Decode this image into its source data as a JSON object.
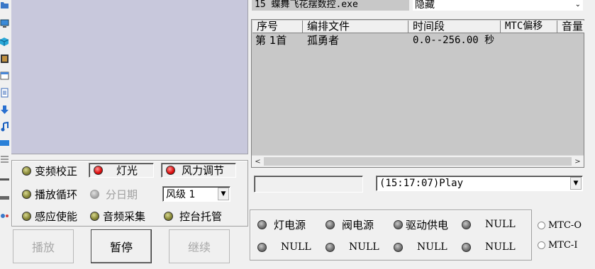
{
  "toolbar_icons": [
    "folder-icon",
    "monitor-icon",
    "cube-icon",
    "film-icon",
    "window-icon",
    "document-icon",
    "download-arrow-icon",
    "music-note-icon",
    "screen-icon",
    "list-icon",
    "dash-icon",
    "panel-icon",
    "network-icon"
  ],
  "top": {
    "program_field": "15 蝶舞飞花摆数控.exe",
    "visibility_select": "隐藏"
  },
  "controls": {
    "freq_correct": "变频校正",
    "lights": "灯光",
    "wind_adjust": "风力调节",
    "play_loop": "播放循环",
    "by_date": "分日期",
    "wind_level_select": "风级 1",
    "sensor_enable": "感应使能",
    "audio_capture": "音频采集",
    "console_host": "控台托管"
  },
  "buttons": {
    "play": "播放",
    "pause": "暂停",
    "resume": "继续"
  },
  "playlist": {
    "columns": [
      "序号",
      "编排文件",
      "时间段",
      "MTC偏移",
      "音量"
    ],
    "rows": [
      {
        "index": "第 1首",
        "file": "孤勇者",
        "time": "0.0--256.00 秒",
        "mtc": "",
        "volume": ""
      }
    ]
  },
  "status": {
    "status_box": "",
    "play_status": "(15:17:07)Play"
  },
  "indicators": {
    "row1": [
      "灯电源",
      "阀电源",
      "驱动供电",
      "NULL"
    ],
    "row2": [
      "NULL",
      "NULL",
      "NULL",
      "NULL"
    ]
  },
  "mtc_radios": [
    "MTC-O",
    "MTC-I"
  ]
}
